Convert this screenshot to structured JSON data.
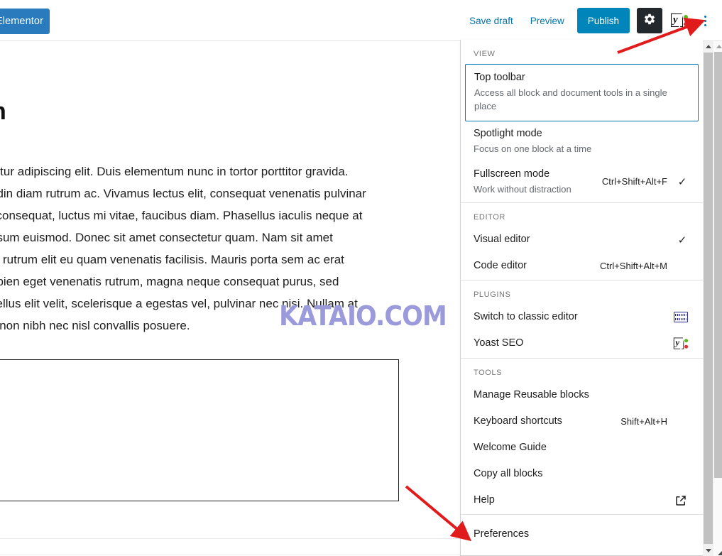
{
  "toolbar": {
    "elementor_label": "Elementor",
    "save_draft_label": "Save draft",
    "preview_label": "Preview",
    "publish_label": "Publish",
    "settings_icon": "gear-icon",
    "yoast_icon": "yoast-seo-icon",
    "more_icon": "kebab-menu-icon",
    "publish_bg": "#0085ba",
    "link_color": "#0073aa",
    "elementor_bg": "#2a7bbd",
    "gear_bg": "#23282d"
  },
  "post": {
    "title": "n",
    "paragraphs": [
      "tetur adipiscing elit. Duis elementum nunc in tortor porttitor gravida.",
      "udin diam rutrum ac. Vivamus lectus elit, consequat venenatis pulvinar",
      "i consequat, luctus mi vitae, faucibus diam. Phasellus iaculis neque at",
      "psum euismod. Donec sit amet consectetur quam. Nam sit amet",
      "in rutrum elit eu quam venenatis facilisis. Mauris porta sem ac erat",
      "apien eget venenatis rutrum, magna neque consequat purus, sed",
      "sellus elit velit, scelerisque a egestas vel, pulvinar nec nisi. Nullam at",
      "lt non nibh nec nisl convallis posuere."
    ],
    "watermark": "KATAIO.COM",
    "watermark_color": "#9b9bdc"
  },
  "menu": {
    "groups": [
      {
        "label": "VIEW",
        "items": [
          {
            "title": "Top toolbar",
            "description": "Access all block and document tools in a single place",
            "shortcut": "",
            "checked": false,
            "selected": true,
            "icon": ""
          },
          {
            "title": "Spotlight mode",
            "description": "Focus on one block at a time",
            "shortcut": "",
            "checked": false,
            "selected": false,
            "icon": ""
          },
          {
            "title": "Fullscreen mode",
            "description": "Work without distraction",
            "shortcut": "Ctrl+Shift+Alt+F",
            "checked": true,
            "selected": false,
            "icon": ""
          }
        ]
      },
      {
        "label": "EDITOR",
        "items": [
          {
            "title": "Visual editor",
            "description": "",
            "shortcut": "",
            "checked": true,
            "selected": false,
            "icon": ""
          },
          {
            "title": "Code editor",
            "description": "",
            "shortcut": "Ctrl+Shift+Alt+M",
            "checked": false,
            "selected": false,
            "icon": ""
          }
        ]
      },
      {
        "label": "PLUGINS",
        "items": [
          {
            "title": "Switch to classic editor",
            "description": "",
            "shortcut": "",
            "checked": false,
            "selected": false,
            "icon": "keyboard-icon"
          },
          {
            "title": "Yoast SEO",
            "description": "",
            "shortcut": "",
            "checked": false,
            "selected": false,
            "icon": "yoast-seo-icon"
          }
        ]
      },
      {
        "label": "TOOLS",
        "items": [
          {
            "title": "Manage Reusable blocks",
            "description": "",
            "shortcut": "",
            "checked": false,
            "selected": false,
            "icon": ""
          },
          {
            "title": "Keyboard shortcuts",
            "description": "",
            "shortcut": "Shift+Alt+H",
            "checked": false,
            "selected": false,
            "icon": ""
          },
          {
            "title": "Welcome Guide",
            "description": "",
            "shortcut": "",
            "checked": false,
            "selected": false,
            "icon": ""
          },
          {
            "title": "Copy all blocks",
            "description": "",
            "shortcut": "",
            "checked": false,
            "selected": false,
            "icon": ""
          },
          {
            "title": "Help",
            "description": "",
            "shortcut": "",
            "checked": false,
            "selected": false,
            "icon": "external-link-icon"
          }
        ]
      },
      {
        "label": "",
        "items": [
          {
            "title": "Preferences",
            "description": "",
            "shortcut": "",
            "checked": false,
            "selected": false,
            "icon": ""
          }
        ]
      }
    ],
    "selected_border_color": "#007cba",
    "check_glyph": "✓"
  },
  "annotations": {
    "color": "#e01b1b",
    "arrows": [
      {
        "name": "arrow-to-more-menu"
      },
      {
        "name": "arrow-to-preferences"
      }
    ]
  }
}
